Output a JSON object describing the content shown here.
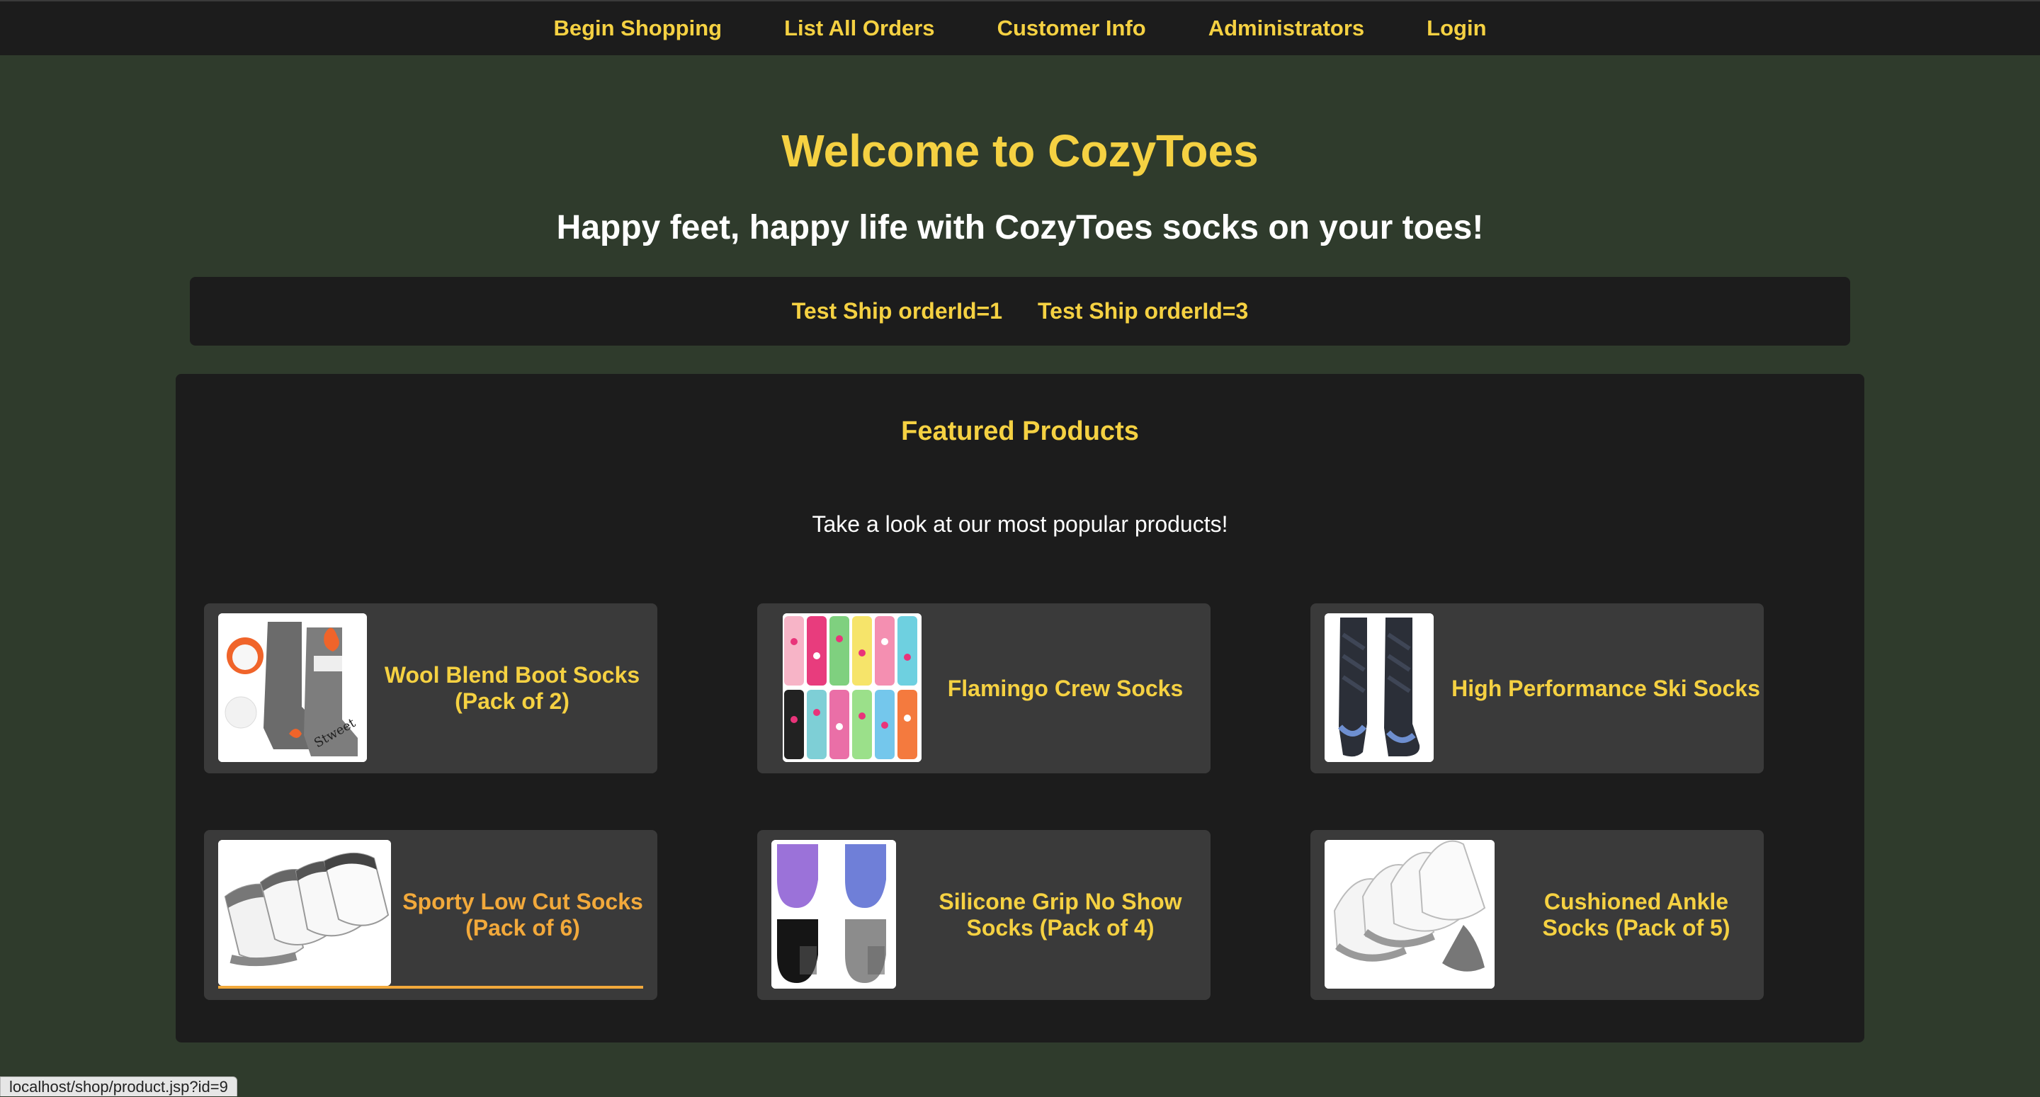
{
  "nav": {
    "items": [
      "Begin Shopping",
      "List All Orders",
      "Customer Info",
      "Administrators",
      "Login"
    ]
  },
  "header": {
    "title": "Welcome to CozyToes",
    "tagline": "Happy feet, happy life with CozyToes socks on your toes!"
  },
  "test_links": [
    "Test Ship orderId=1",
    "Test Ship orderId=3"
  ],
  "featured": {
    "heading": "Featured Products",
    "subheading": "Take a look at our most popular products!",
    "products": [
      {
        "name": "Wool Blend Boot Socks (Pack of 2)",
        "image": "wool-boot-socks-image"
      },
      {
        "name": "Flamingo Crew Socks",
        "image": "flamingo-crew-socks-image"
      },
      {
        "name": "High Performance Ski Socks",
        "image": "ski-socks-image"
      },
      {
        "name": "Sporty Low Cut Socks (Pack of 6)",
        "image": "low-cut-socks-image"
      },
      {
        "name": "Silicone Grip No Show Socks (Pack of 4)",
        "image": "no-show-socks-image"
      },
      {
        "name": "Cushioned Ankle Socks (Pack of 5)",
        "image": "ankle-socks-image"
      }
    ]
  },
  "status_url": "localhost/shop/product.jsp?id=9",
  "colors": {
    "accent": "#f5d142",
    "hover": "#f2a93b",
    "background": "#2f3b2c",
    "panel": "#1c1c1c",
    "card": "#3a3a3a"
  }
}
